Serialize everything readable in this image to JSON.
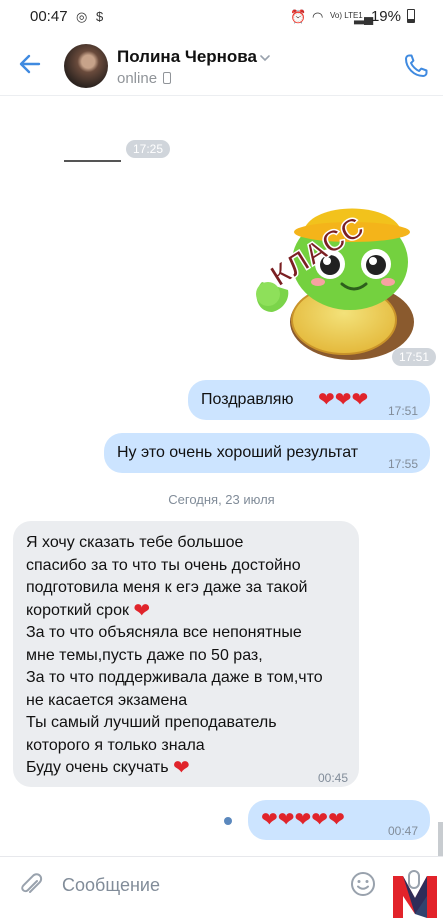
{
  "status_bar": {
    "time": "00:47",
    "battery": "19%",
    "network": "Vo) LTE1"
  },
  "header": {
    "contact_name": "Полина Чернова",
    "status": "online"
  },
  "chat": {
    "underline_time": "17:25",
    "sticker": {
      "text": "КЛАСС",
      "time": "17:51"
    },
    "messages_out": [
      {
        "text": "Поздравляю",
        "time": "17:51"
      },
      {
        "text": "Ну это очень хороший результат",
        "time": "17:55"
      }
    ],
    "date_separator": "Сегодня, 23 июля",
    "message_in": {
      "lines": [
        "Я хочу сказать тебе большое",
        "спасибо за то что ты очень достойно",
        "подготовила меня к егэ даже за такой",
        "короткий срок",
        "За то что объясняла все непонятные",
        "мне темы,пусть даже по 50 раз,",
        "За то что поддерживала даже в том,что",
        "не касается экзамена",
        "Ты самый лучший преподаватель",
        "которого я только знала",
        "Буду очень скучать"
      ],
      "time": "00:45"
    },
    "last_out": {
      "time": "00:47"
    }
  },
  "composer": {
    "placeholder": "Сообщение"
  },
  "colors": {
    "accent": "#3f8ae0",
    "bubble_out": "#cce4ff",
    "bubble_in": "#ebedf0",
    "heart": "#e0242b"
  }
}
